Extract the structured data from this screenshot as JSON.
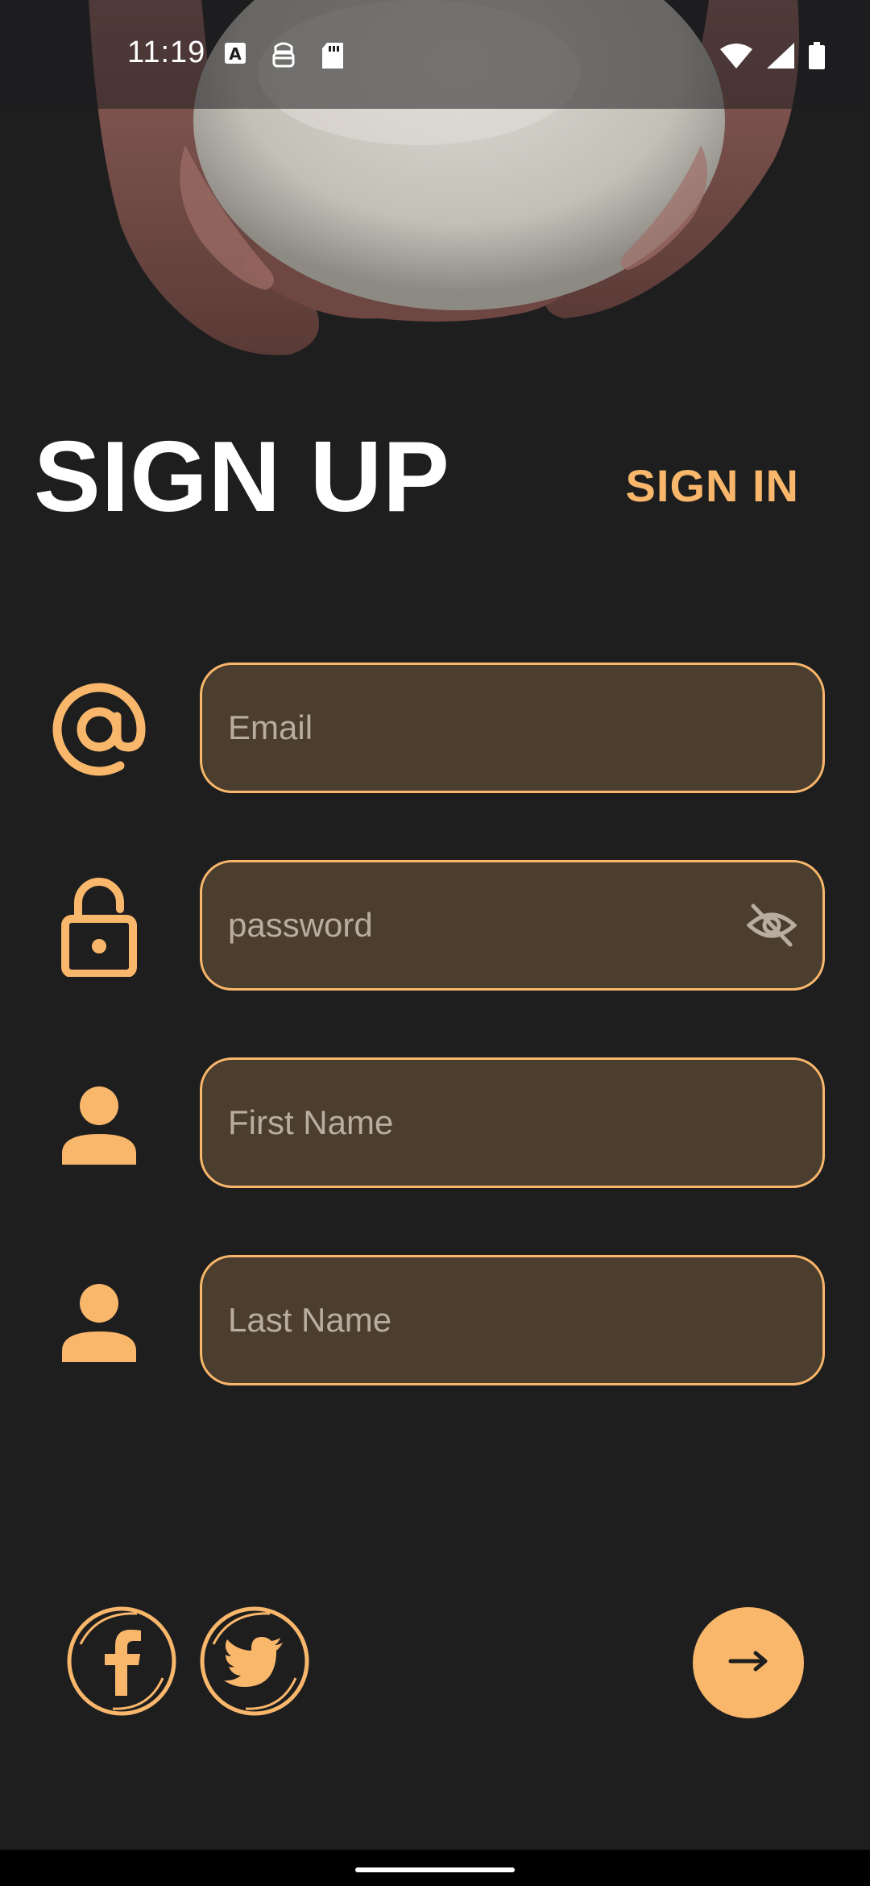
{
  "status_bar": {
    "time": "11:19",
    "icons": [
      "keyboard-a-icon",
      "robot-icon",
      "sd-card-icon",
      "wifi-icon",
      "signal-icon",
      "battery-icon"
    ]
  },
  "hero": {
    "image": "hands-holding-dough"
  },
  "header": {
    "title": "SIGN UP",
    "signin_label": "SIGN IN"
  },
  "form": {
    "email_placeholder": "Email",
    "password_placeholder": "password",
    "first_name_placeholder": "First Name",
    "last_name_placeholder": "Last Name"
  },
  "social": [
    "facebook-icon",
    "twitter-icon"
  ],
  "colors": {
    "background": "#1e1e1f",
    "accent": "#f9b76b",
    "field_fill": "#4c3e2f",
    "placeholder": "#b9ad9f"
  }
}
